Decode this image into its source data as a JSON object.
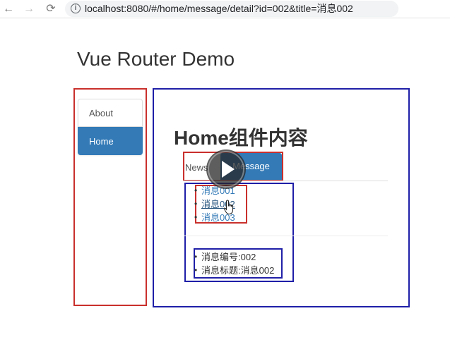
{
  "browser": {
    "back_icon": "←",
    "forward_icon": "→",
    "reload_icon": "⟳",
    "url": "localhost:8080/#/home/message/detail?id=002&title=消息002"
  },
  "page": {
    "title": "Vue Router Demo"
  },
  "sidebar": {
    "items": [
      {
        "label": "About",
        "active": false
      },
      {
        "label": "Home",
        "active": true
      }
    ]
  },
  "home": {
    "title": "Home组件内容",
    "tabs": [
      {
        "label": "News",
        "active": false
      },
      {
        "label": "Message",
        "active": true
      }
    ],
    "messages": [
      {
        "label": "消息001"
      },
      {
        "label": "消息002"
      },
      {
        "label": "消息003"
      }
    ],
    "detail": {
      "id_line": "消息编号:002",
      "title_line": "消息标题:消息002"
    }
  },
  "colors": {
    "annotation_red": "#c9302c",
    "annotation_blue": "#1f1fa8",
    "active_blue": "#337ab7"
  }
}
